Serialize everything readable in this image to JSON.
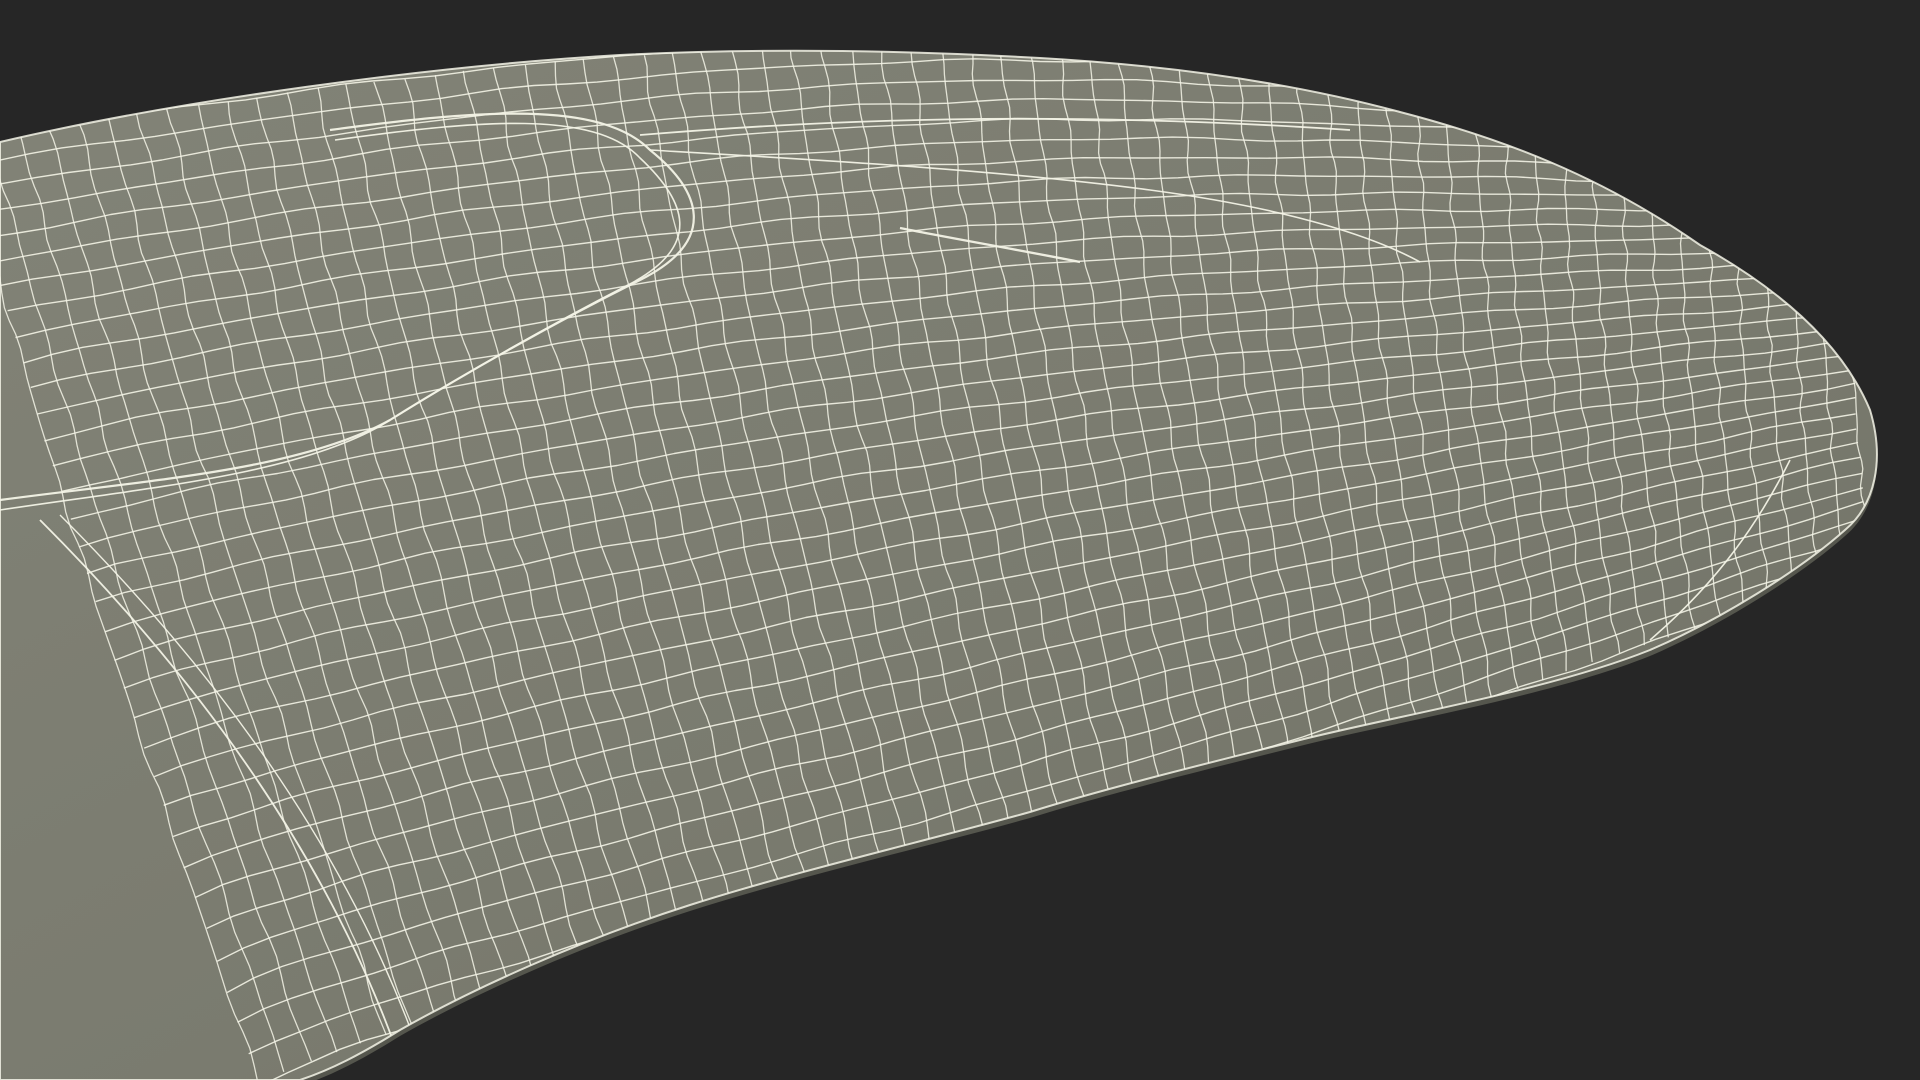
{
  "scene": {
    "subject": "wireframe-mesh-surface",
    "colors": {
      "background": "#262626",
      "surface": "#7a7b6f",
      "surface_shadow": "#6c6d62",
      "wire": "#f3f3e6",
      "edge_shadow": "#55564d"
    }
  }
}
